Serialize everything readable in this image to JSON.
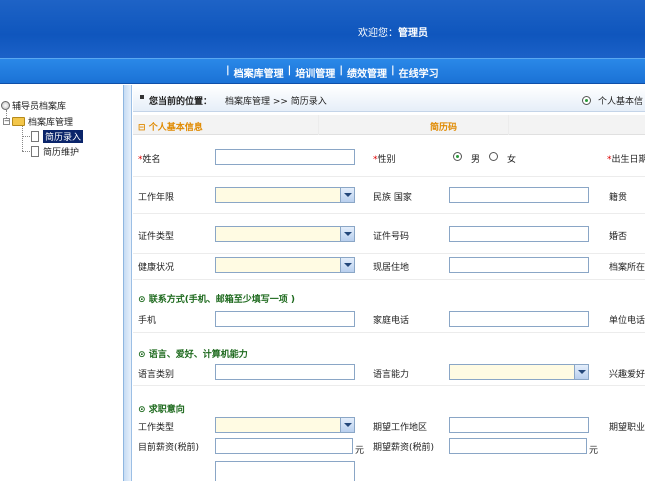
{
  "header": {
    "welcome_text": "欢迎您：",
    "user": "管理员"
  },
  "nav": {
    "items": [
      "档案库管理",
      "培训管理",
      "绩效管理",
      "在线学习"
    ],
    "separator": "|"
  },
  "tree": {
    "root": "辅导员档案库",
    "folder": "档案库管理",
    "children": [
      "简历录入",
      "简历维护"
    ]
  },
  "breadcrumb": {
    "label": "您当前的位置：",
    "path": "档案库管理 >> 简历录入",
    "radio_label": "个人基本信"
  },
  "sections": {
    "basic": {
      "title": "个人基本信息",
      "code_label": "简历码",
      "toggle": "⊟"
    },
    "contact": {
      "title": "联系方式(手机、邮箱至少填写一项 )"
    },
    "language": {
      "title": "语言、爱好、计算机能力"
    },
    "job": {
      "title": "求职意向"
    }
  },
  "fields": {
    "name": "姓名",
    "gender": "性别",
    "male": "男",
    "female": "女",
    "birth": "出生日期",
    "work_years": "工作年限",
    "nation": "民族 国家",
    "native": "籍贯",
    "id_type": "证件类型",
    "id_number": "证件号码",
    "married": "婚否",
    "health": "健康状况",
    "residence": "现居住地",
    "archive_place": "档案所在",
    "mobile": "手机",
    "home_phone": "家庭电话",
    "work_phone": "单位电话",
    "lang_type": "语言类别",
    "lang_ability": "语言能力",
    "hobby": "兴趣爱好",
    "job_type": "工作类型",
    "work_area": "期望工作地区",
    "job_title": "期望职业",
    "cur_salary": "目前薪资(税前)",
    "exp_salary": "期望薪资(税前)",
    "yuan": "元"
  },
  "colors": {
    "banner": "#1259c0",
    "navbar": "#2a86e6",
    "section_orange": "#e08a00",
    "section_green": "#1e6a1e"
  }
}
